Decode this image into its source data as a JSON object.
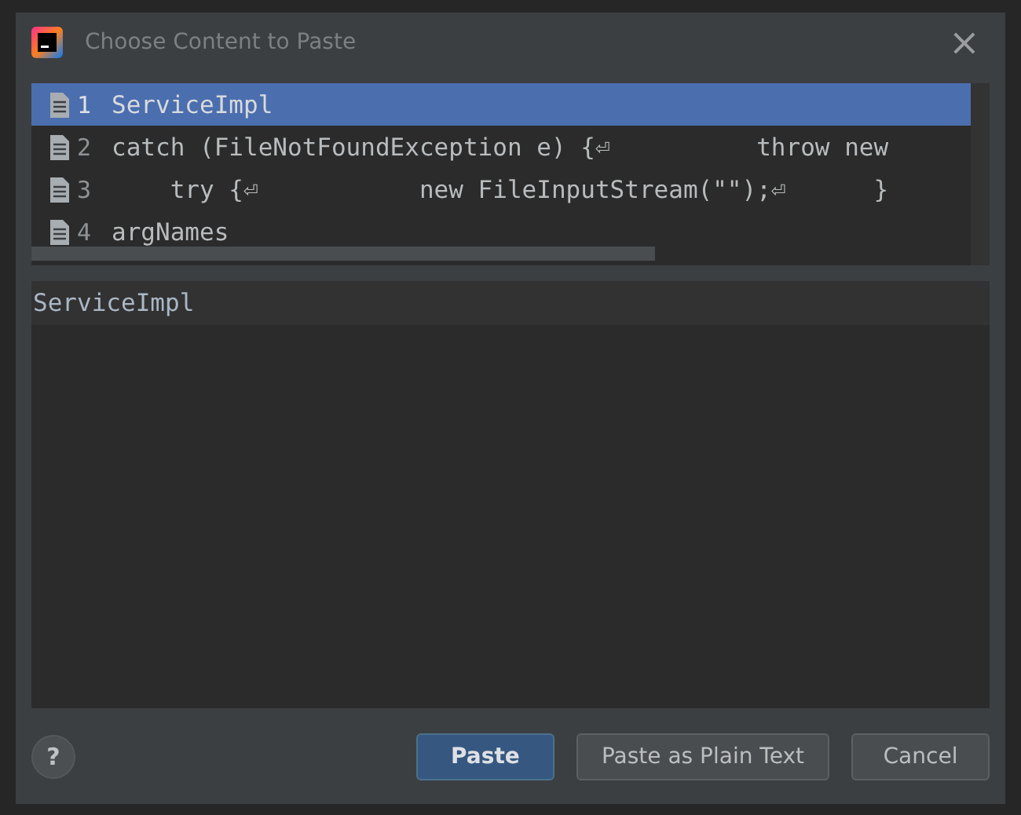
{
  "window": {
    "title": "Choose Content to Paste",
    "close": "×"
  },
  "clips": [
    {
      "number": "1",
      "text": "ServiceImpl",
      "selected": true
    },
    {
      "number": "2",
      "text": "catch (FileNotFoundException e) {⏎          throw new",
      "selected": false
    },
    {
      "number": "3",
      "text": "    try {⏎           new FileInputStream(\"\");⏎      }",
      "selected": false
    },
    {
      "number": "4",
      "text": "argNames",
      "selected": false
    }
  ],
  "preview": {
    "text": "ServiceImpl"
  },
  "help": "?",
  "buttons": [
    {
      "label": "Paste",
      "kind": "primary"
    },
    {
      "label": "Paste as Plain Text",
      "kind": "normal"
    },
    {
      "label": "Cancel",
      "kind": "normal"
    }
  ]
}
